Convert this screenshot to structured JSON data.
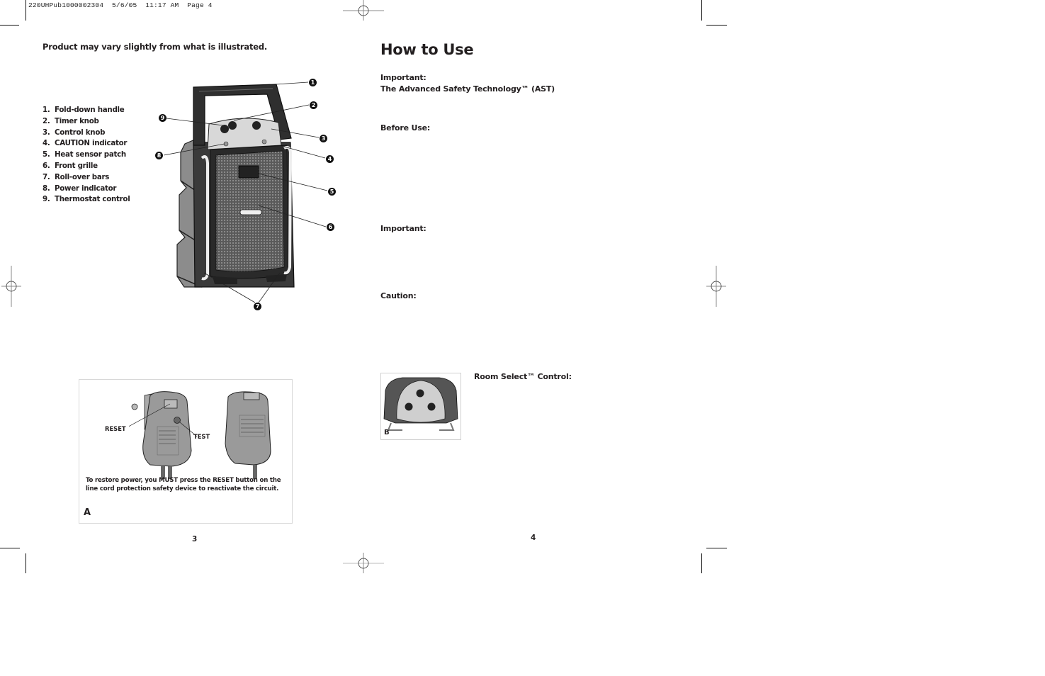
{
  "slug": "220UHPub1000002304  5/6/05  11:17 AM  Page 4",
  "left_page": {
    "note": "Product may vary slightly from what is illustrated.",
    "parts": [
      {
        "num": "1.",
        "label": "Fold-down handle"
      },
      {
        "num": "2.",
        "label": "Timer knob"
      },
      {
        "num": "3.",
        "label": "Control knob"
      },
      {
        "num": "4.",
        "label": "CAUTION indicator"
      },
      {
        "num": "5.",
        "label": "Heat sensor patch"
      },
      {
        "num": "6.",
        "label": "Front grille"
      },
      {
        "num": "7.",
        "label": "Roll-over bars"
      },
      {
        "num": "8.",
        "label": "Power indicator"
      },
      {
        "num": "9.",
        "label": "Thermostat control"
      }
    ],
    "callout_numbers": [
      "1",
      "2",
      "3",
      "4",
      "5",
      "6",
      "7",
      "8",
      "9"
    ],
    "figure_a": {
      "reset_label": "RESET",
      "test_label": "TEST",
      "caption": "To restore power, you MUST press the RESET button on the line cord protection safety device to reactivate the circuit.",
      "letter": "A"
    },
    "page_number": "3"
  },
  "right_page": {
    "title": "How to Use",
    "important_1": "Important:",
    "ast": "The Advanced Safety Technology™ (AST)",
    "before_use": "Before Use:",
    "important_2": "Important:",
    "caution": "Caution:",
    "room_select": "Room Select™  Control:",
    "figure_b": {
      "letter": "B"
    },
    "page_number": "4"
  }
}
